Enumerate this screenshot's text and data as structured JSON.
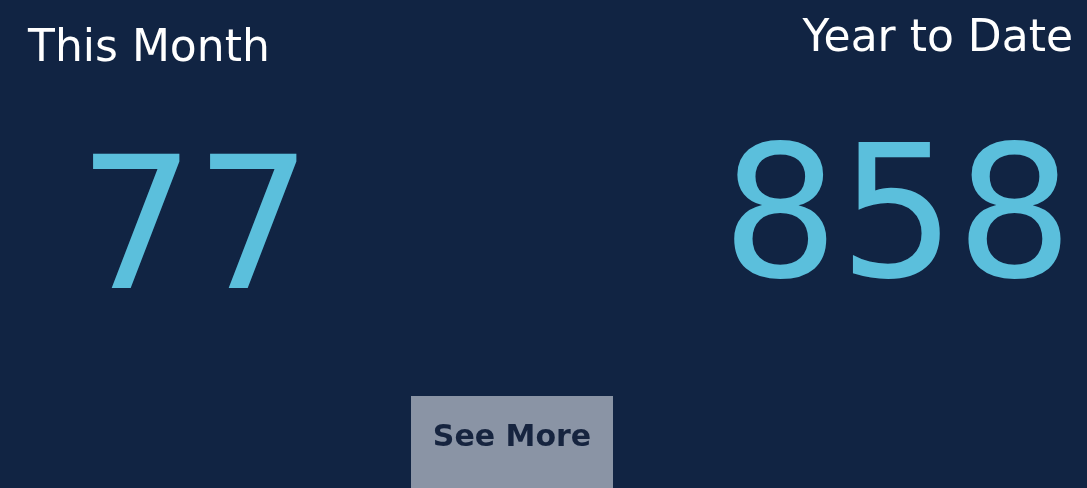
{
  "cards": [
    {
      "title": "This Month",
      "value": "77"
    },
    {
      "title": "Year to Date",
      "value": "858"
    }
  ],
  "button": {
    "label": "See More"
  }
}
